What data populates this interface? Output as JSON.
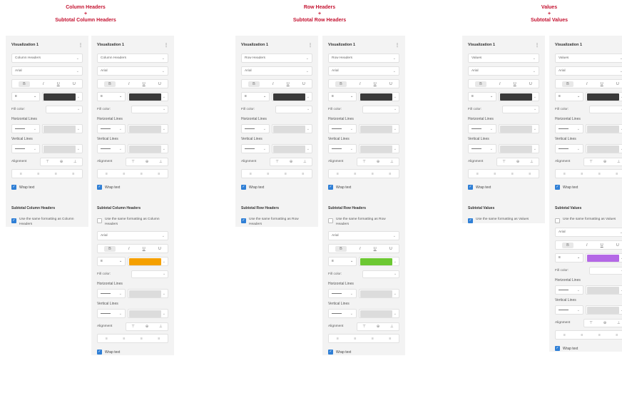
{
  "sections": [
    {
      "title": "Column Headers",
      "plus": "+",
      "subtitle": "Subtotal Column Headers"
    },
    {
      "title": "Row Headers",
      "plus": "+",
      "subtitle": "Subtotal Row Headers"
    },
    {
      "title": "Values",
      "plus": "+",
      "subtitle": "Subtotal Values"
    }
  ],
  "common": {
    "panel_title": "Visualization 1",
    "font": "Arial",
    "bold": "B",
    "italic": "I",
    "underline": "U",
    "underline2": "U",
    "size": "8",
    "fill_color": "Fill color:",
    "horizontal_lines": "Horizontal Lines",
    "vertical_lines": "Vertical Lines",
    "alignment": "Alignment",
    "wrap_text": "Wrap text",
    "text_color_dark": "#3a3a3a"
  },
  "panels": [
    {
      "section": "Column Headers",
      "subtotal_title": "Subtotal Column Headers",
      "checkbox": "Use the same formatting as Column Headers",
      "checked": true
    },
    {
      "section": "Column Headers",
      "subtotal_title": "Subtotal Column Headers",
      "checkbox": "Use the same formatting as Column Headers",
      "checked": false,
      "subtotal_color": "#f5a000"
    },
    {
      "section": "Row Headers",
      "subtotal_title": "Subtotal Row Headers",
      "checkbox": "Use the same formatting as Row Headers",
      "checked": true
    },
    {
      "section": "Row Headers",
      "subtotal_title": "Subtotal Row Headers",
      "checkbox": "Use the same formatting as Row Headers",
      "checked": false,
      "subtotal_color": "#6cc832"
    },
    {
      "section": "Values",
      "subtotal_title": "Subtotal Values",
      "checkbox": "Use the same formatting as Values",
      "checked": true
    },
    {
      "section": "Values",
      "subtotal_title": "Subtotal Values",
      "checkbox": "Use the same formatting as Values",
      "checked": false,
      "subtotal_color": "#b468e6"
    }
  ],
  "icons": {
    "more": "⋮",
    "chevron": "⌄",
    "check": "✓",
    "align_top": "⊤",
    "align_mid": "⊕",
    "align_bot": "⊥",
    "h_align": "≡"
  }
}
